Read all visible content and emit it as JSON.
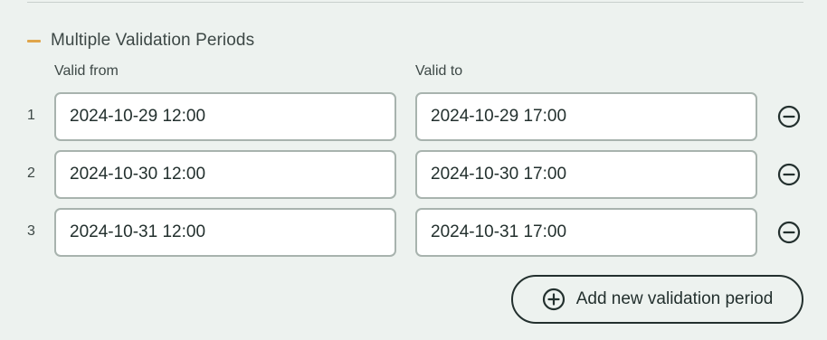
{
  "section": {
    "title": "Multiple Validation Periods",
    "accent_color": "#e0a54a"
  },
  "columns": {
    "from_label": "Valid from",
    "to_label": "Valid to"
  },
  "periods": [
    {
      "index": "1",
      "from": "2024-10-29 12:00",
      "to": "2024-10-29 17:00",
      "remove_icon": "minus-circle-icon"
    },
    {
      "index": "2",
      "from": "2024-10-30 12:00",
      "to": "2024-10-30 17:00",
      "remove_icon": "minus-circle-icon"
    },
    {
      "index": "3",
      "from": "2024-10-31 12:00",
      "to": "2024-10-31 17:00",
      "remove_icon": "minus-circle-icon"
    }
  ],
  "add_button": {
    "label": "Add new validation period",
    "icon": "plus-circle-icon"
  }
}
